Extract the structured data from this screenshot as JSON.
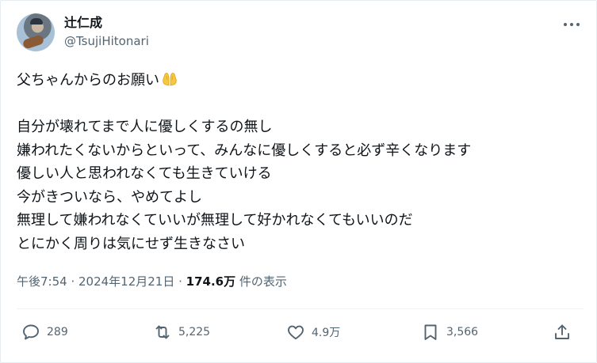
{
  "author": {
    "display_name": "辻仁成",
    "handle": "@TsujiHitonari",
    "avatar_icon": "avatar-photo-guitar"
  },
  "menu": {
    "more_icon": "more-horizontal-icon",
    "more_label": "•••"
  },
  "post": {
    "lines": [
      "父ちゃんからのお願い",
      "",
      "自分が壊れてまで人に優しくするの無し",
      "嫌われたくないからといって、みんなに優しくすると必ず辛くなります",
      "優しい人と思われなくても生きていける",
      "今がきついなら、やめてよし",
      "無理して嫌われなくていいが無理して好かれなくてもいいのだ",
      "とにかく周りは気にせず生きなさい"
    ],
    "emoji": "praying-hands-emoji"
  },
  "meta": {
    "time": "午後7:54",
    "separator1": " · ",
    "date": "2024年12月21日",
    "separator2": " · ",
    "views": "174.6万",
    "views_suffix": " 件の表示"
  },
  "actions": {
    "replies": "289",
    "reposts": "5,225",
    "likes": "4.9万",
    "bookmarks": "3,566"
  },
  "colors": {
    "text": "#0f1419",
    "secondary": "#536471",
    "border": "#eff3f4",
    "emoji": "#f6c83f"
  }
}
